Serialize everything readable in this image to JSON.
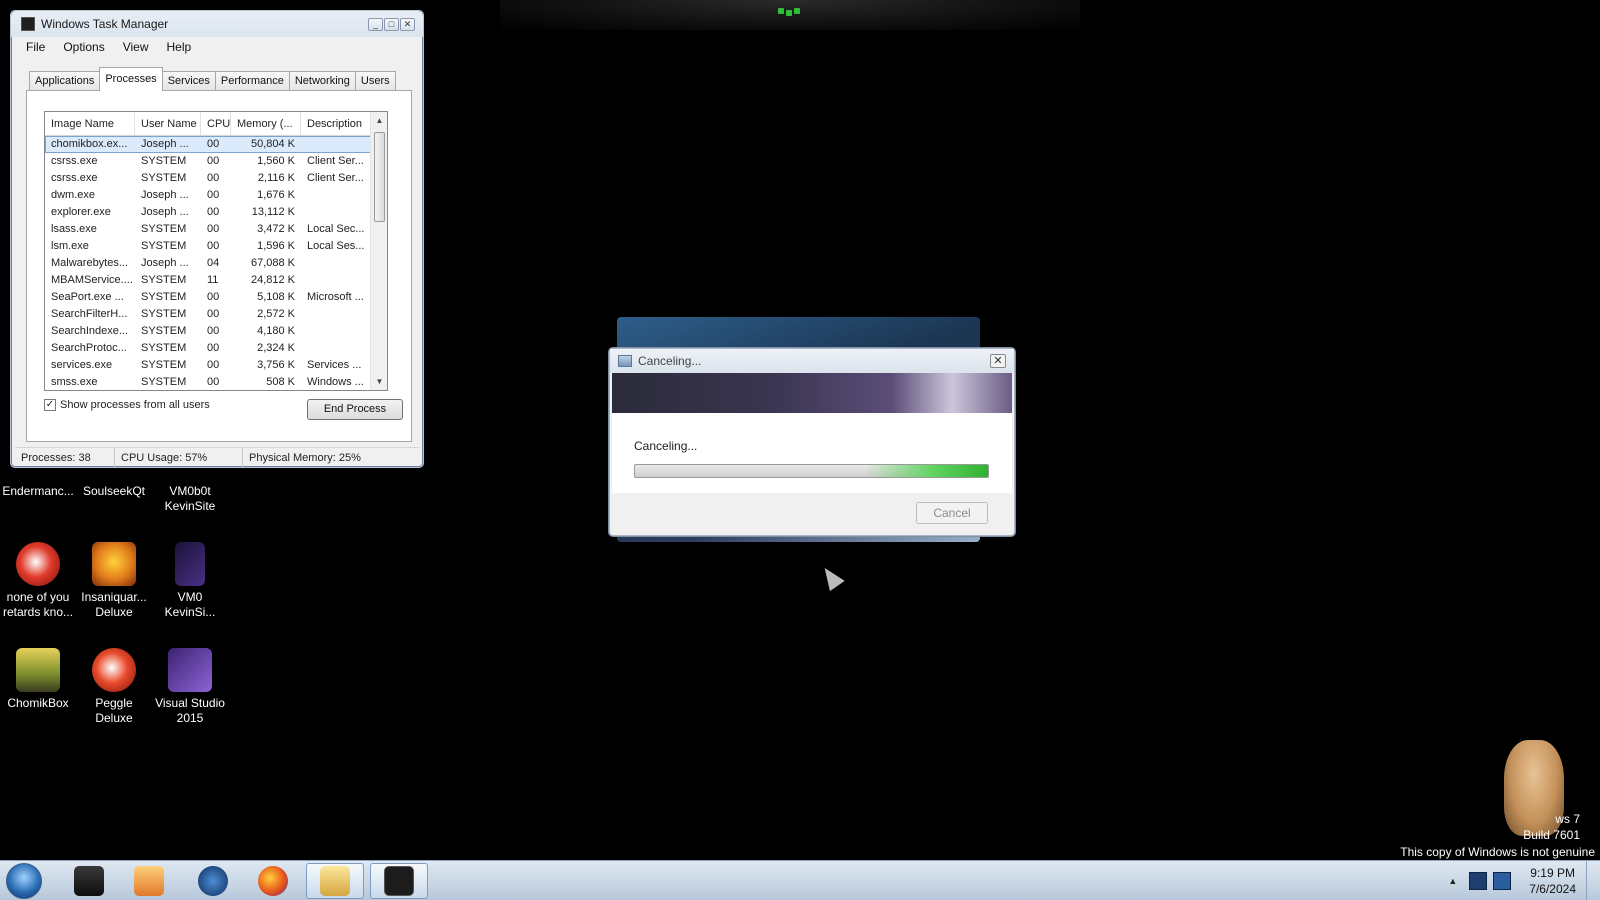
{
  "task_manager": {
    "title": "Windows Task Manager",
    "menu": [
      "File",
      "Options",
      "View",
      "Help"
    ],
    "tabs": [
      "Applications",
      "Processes",
      "Services",
      "Performance",
      "Networking",
      "Users"
    ],
    "active_tab": "Processes",
    "columns": [
      "Image Name",
      "User Name",
      "CPU",
      "Memory (...",
      "Description"
    ],
    "rows": [
      [
        "chomikbox.ex...",
        "Joseph ...",
        "00",
        "50,804 K",
        ""
      ],
      [
        "csrss.exe",
        "SYSTEM",
        "00",
        "1,560 K",
        "Client Ser..."
      ],
      [
        "csrss.exe",
        "SYSTEM",
        "00",
        "2,116 K",
        "Client Ser..."
      ],
      [
        "dwm.exe",
        "Joseph ...",
        "00",
        "1,676 K",
        ""
      ],
      [
        "explorer.exe",
        "Joseph ...",
        "00",
        "13,112 K",
        ""
      ],
      [
        "lsass.exe",
        "SYSTEM",
        "00",
        "3,472 K",
        "Local Sec..."
      ],
      [
        "lsm.exe",
        "SYSTEM",
        "00",
        "1,596 K",
        "Local Ses..."
      ],
      [
        "Malwarebytes...",
        "Joseph ...",
        "04",
        "67,088 K",
        ""
      ],
      [
        "MBAMService....",
        "SYSTEM",
        "11",
        "24,812 K",
        ""
      ],
      [
        "SeaPort.exe ...",
        "SYSTEM",
        "00",
        "5,108 K",
        "Microsoft ..."
      ],
      [
        "SearchFilterH...",
        "SYSTEM",
        "00",
        "2,572 K",
        ""
      ],
      [
        "SearchIndexe...",
        "SYSTEM",
        "00",
        "4,180 K",
        ""
      ],
      [
        "SearchProtoc...",
        "SYSTEM",
        "00",
        "2,324 K",
        ""
      ],
      [
        "services.exe",
        "SYSTEM",
        "00",
        "3,756 K",
        "Services ..."
      ],
      [
        "smss.exe",
        "SYSTEM",
        "00",
        "508 K",
        "Windows ..."
      ]
    ],
    "show_all_label": "Show processes from all users",
    "show_all_checked": true,
    "end_process_label": "End Process",
    "status": {
      "processes": "Processes: 38",
      "cpu": "CPU Usage: 57%",
      "memory": "Physical Memory: 25%"
    }
  },
  "desktop_icons": [
    {
      "label": "Endermanc...",
      "icon": "app-icon"
    },
    {
      "label": "SoulseekQt",
      "icon": "app-icon"
    },
    {
      "label": "VM0b0t KevinSite",
      "icon": "app-icon"
    },
    {
      "label": "none of you retards kno...",
      "icon": "peggle-icon"
    },
    {
      "label": "Insaniquar... Deluxe",
      "icon": "insaniquarium-icon"
    },
    {
      "label": "VM0 KevinSi...",
      "icon": "visual-studio-icon"
    },
    {
      "label": "ChomikBox",
      "icon": "chomikbox-icon"
    },
    {
      "label": "Peggle Deluxe",
      "icon": "peggle-icon"
    },
    {
      "label": "Visual Studio 2015",
      "icon": "visual-studio-icon"
    }
  ],
  "cancel_dialog": {
    "title": "Canceling...",
    "message": "Canceling...",
    "cancel_label": "Cancel",
    "progress_state": "indeterminate"
  },
  "watermark": {
    "line1": "ws 7",
    "line2": "Build 7601",
    "line3": "This copy of Windows is not genuine"
  },
  "taskbar": {
    "items": [
      "terminal-icon",
      "media-player-icon",
      "globe-icon",
      "firefox-icon",
      "folder-icon",
      "task-manager-icon"
    ],
    "clock_time": "9:19 PM",
    "clock_date": "7/6/2024"
  },
  "colors": {
    "progress_green": "#3fc43f",
    "desktop_bg": "#000000",
    "taskbar": "#c8d6e6"
  }
}
